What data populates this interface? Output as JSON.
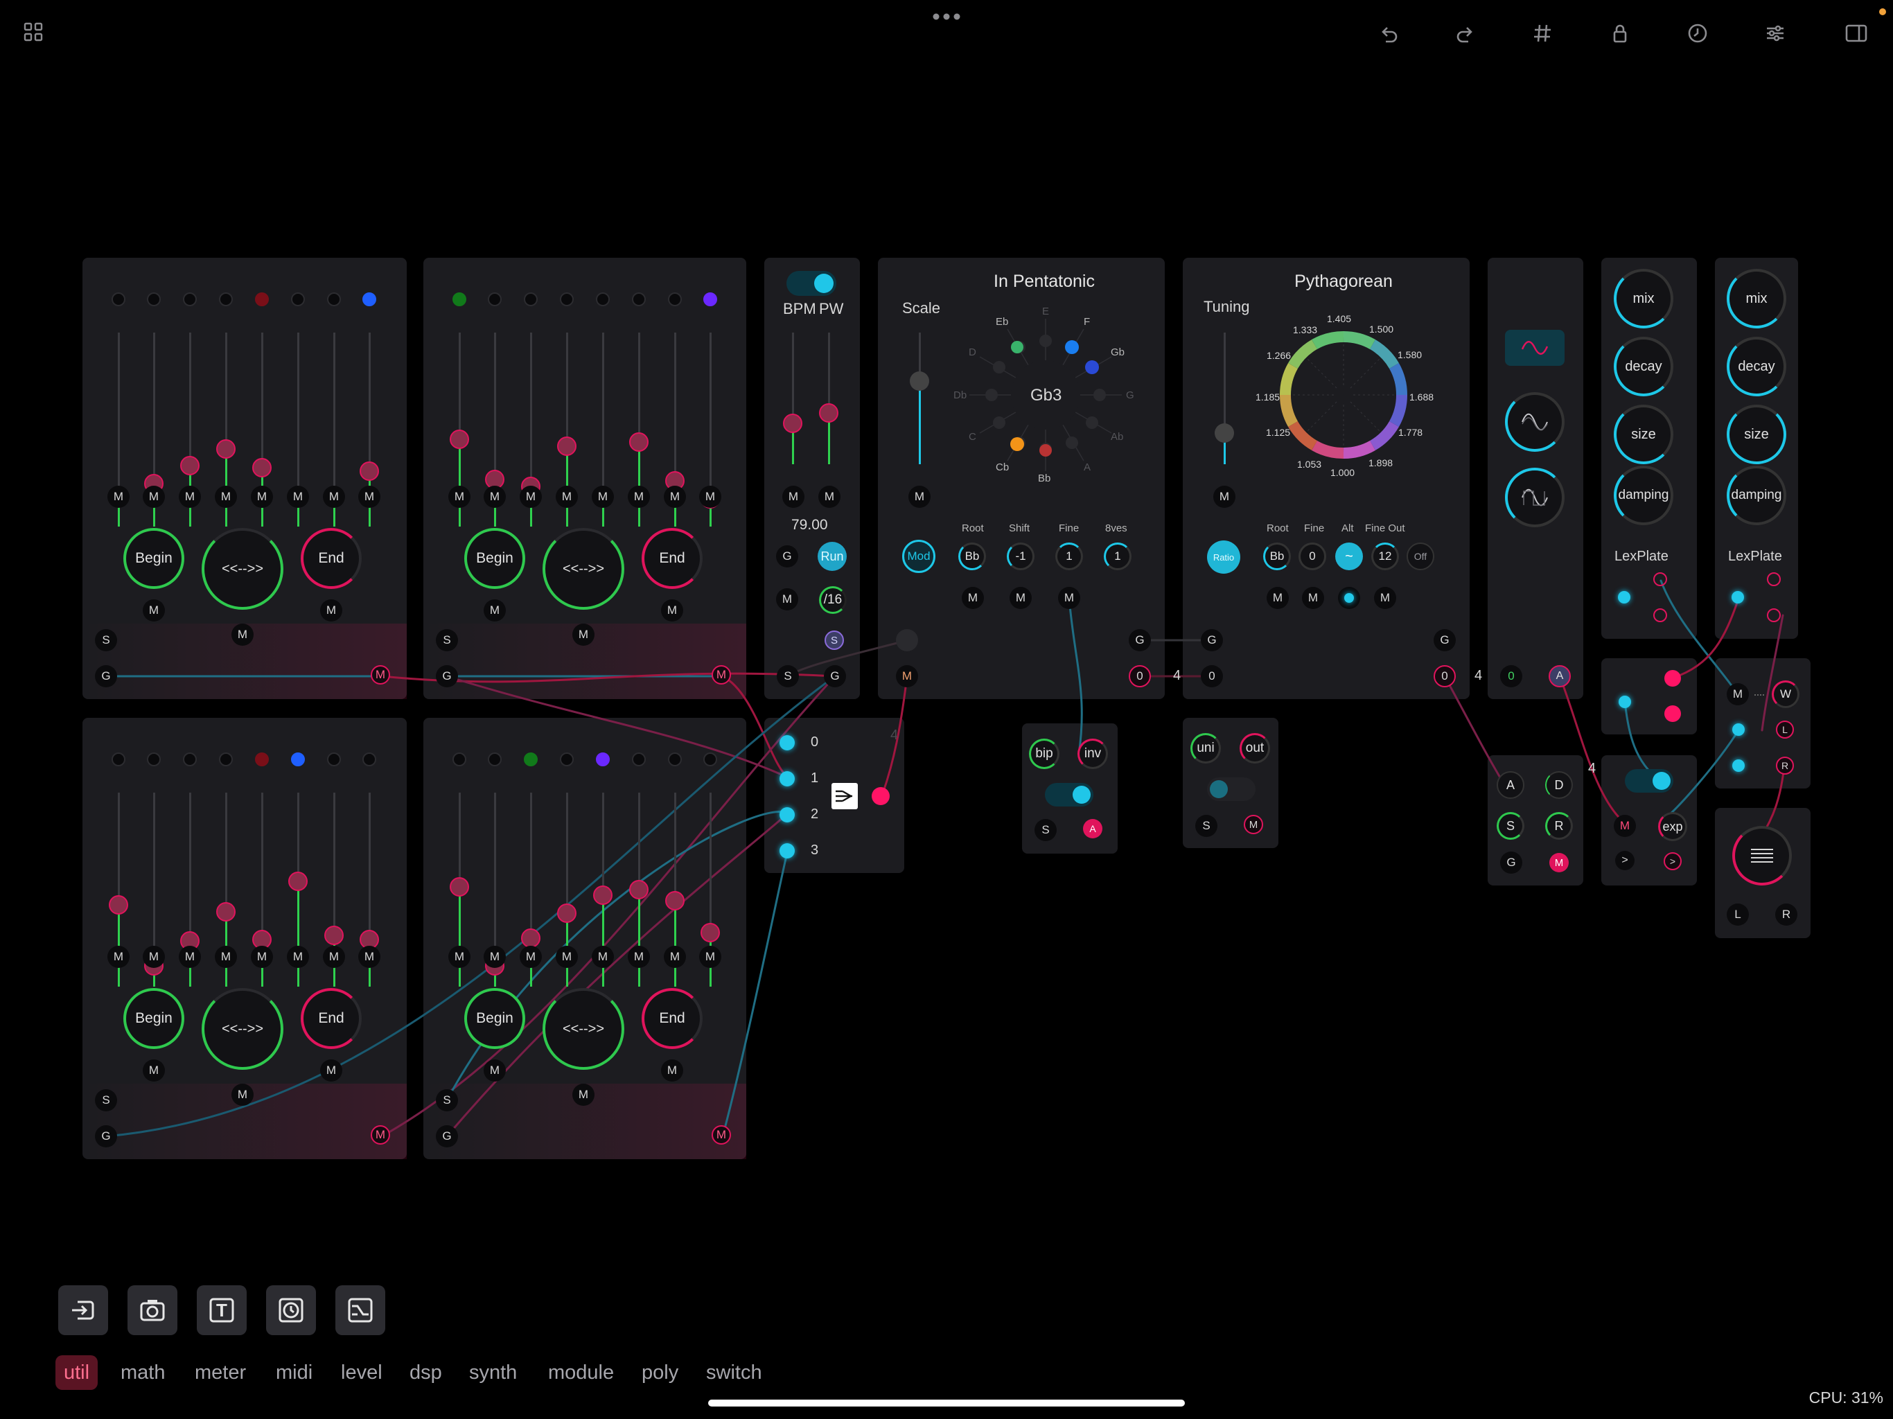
{
  "toolbar": {
    "icons": [
      "grid-icon",
      "more-icon",
      "undo-icon",
      "redo-icon",
      "hash-icon",
      "lock-icon",
      "history-icon",
      "sliders-icon",
      "sidebar-icon"
    ]
  },
  "colors": {
    "accent": "#1ec8e8",
    "pink": "#e0145c",
    "green": "#37c94e",
    "panel": "#1c1c20"
  },
  "sequencers": [
    {
      "begin": "Begin",
      "middle": "<<-->>",
      "end": "End",
      "s": "S",
      "g": "G",
      "m": "M"
    },
    {
      "begin": "Begin",
      "middle": "<<-->>",
      "end": "End",
      "s": "S",
      "g": "G",
      "m": "M"
    },
    {
      "begin": "Begin",
      "middle": "<<-->>",
      "end": "End",
      "s": "S",
      "g": "G",
      "m": "M"
    },
    {
      "begin": "Begin",
      "middle": "<<-->>",
      "end": "End",
      "s": "S",
      "g": "G",
      "m": "M"
    }
  ],
  "clock": {
    "bpm": "BPM",
    "pw": "PW",
    "value": "79.00",
    "run": "Run",
    "div": "/16",
    "g": "G",
    "s": "S",
    "m": "M",
    "seq_out": "S"
  },
  "switch": {
    "ports": [
      "0",
      "1",
      "2",
      "3"
    ],
    "count": "4"
  },
  "pentatonic": {
    "title": "In Pentatonic",
    "scale": "Scale",
    "center": "Gb3",
    "mod": "Mod",
    "labels": {
      "root": "Root",
      "shift": "Shift",
      "fine": "Fine",
      "8ves": "8ves"
    },
    "values": {
      "root": "Bb",
      "shift": "-1",
      "fine": "1",
      "8ves": "1"
    },
    "notes": [
      "Eb",
      "E",
      "F",
      "Gb",
      "G",
      "Ab",
      "A",
      "Bb",
      "Cb",
      "C",
      "Db",
      "D"
    ],
    "g": "G",
    "o": "0",
    "m": "M",
    "count": "4"
  },
  "pythagorean": {
    "title": "Pythagorean",
    "tuning": "Tuning",
    "ratio": "Ratio",
    "labels": {
      "root": "Root",
      "fine": "Fine",
      "alt": "Alt",
      "fineout": "Fine Out"
    },
    "values": {
      "root": "Bb",
      "fine": "0",
      "alt": "~",
      "fineout": "12",
      "off": "Off"
    },
    "ratios": [
      "1.405",
      "1.500",
      "1.580",
      "1.688",
      "1.778",
      "1.898",
      "1.000",
      "1.053",
      "1.125",
      "1.185",
      "1.266",
      "1.333"
    ],
    "g": "G",
    "o": "0",
    "m": "M",
    "count": "4"
  },
  "lfo": {
    "o": "0",
    "a": "A"
  },
  "biploar": {
    "bip": "bip",
    "inv": "inv",
    "s": "S",
    "a": "A"
  },
  "uni": {
    "uni": "uni",
    "out": "out",
    "s": "S",
    "m": "M"
  },
  "adsr": {
    "a": "A",
    "d": "D",
    "s": "S",
    "r": "R",
    "g": "G",
    "m": "M",
    "count": "4"
  },
  "env2": {
    "m": "M",
    "exp": "exp"
  },
  "reverb1": {
    "mix": "mix",
    "decay": "decay",
    "size": "size",
    "damping": "damping",
    "name": "LexPlate"
  },
  "reverb2": {
    "mix": "mix",
    "decay": "decay",
    "size": "size",
    "damping": "damping",
    "name": "LexPlate"
  },
  "output": {
    "m": "M",
    "w": "W",
    "l": "L",
    "r": "R"
  },
  "bottom": {
    "tools": [
      "input-icon",
      "camera-icon",
      "text-icon",
      "clock-icon",
      "filter-icon"
    ],
    "text_tool": "T",
    "categories": [
      "util",
      "math",
      "meter",
      "midi",
      "level",
      "dsp",
      "synth",
      "module",
      "poly",
      "switch"
    ],
    "active": "util"
  },
  "cpu": "CPU: 31%"
}
